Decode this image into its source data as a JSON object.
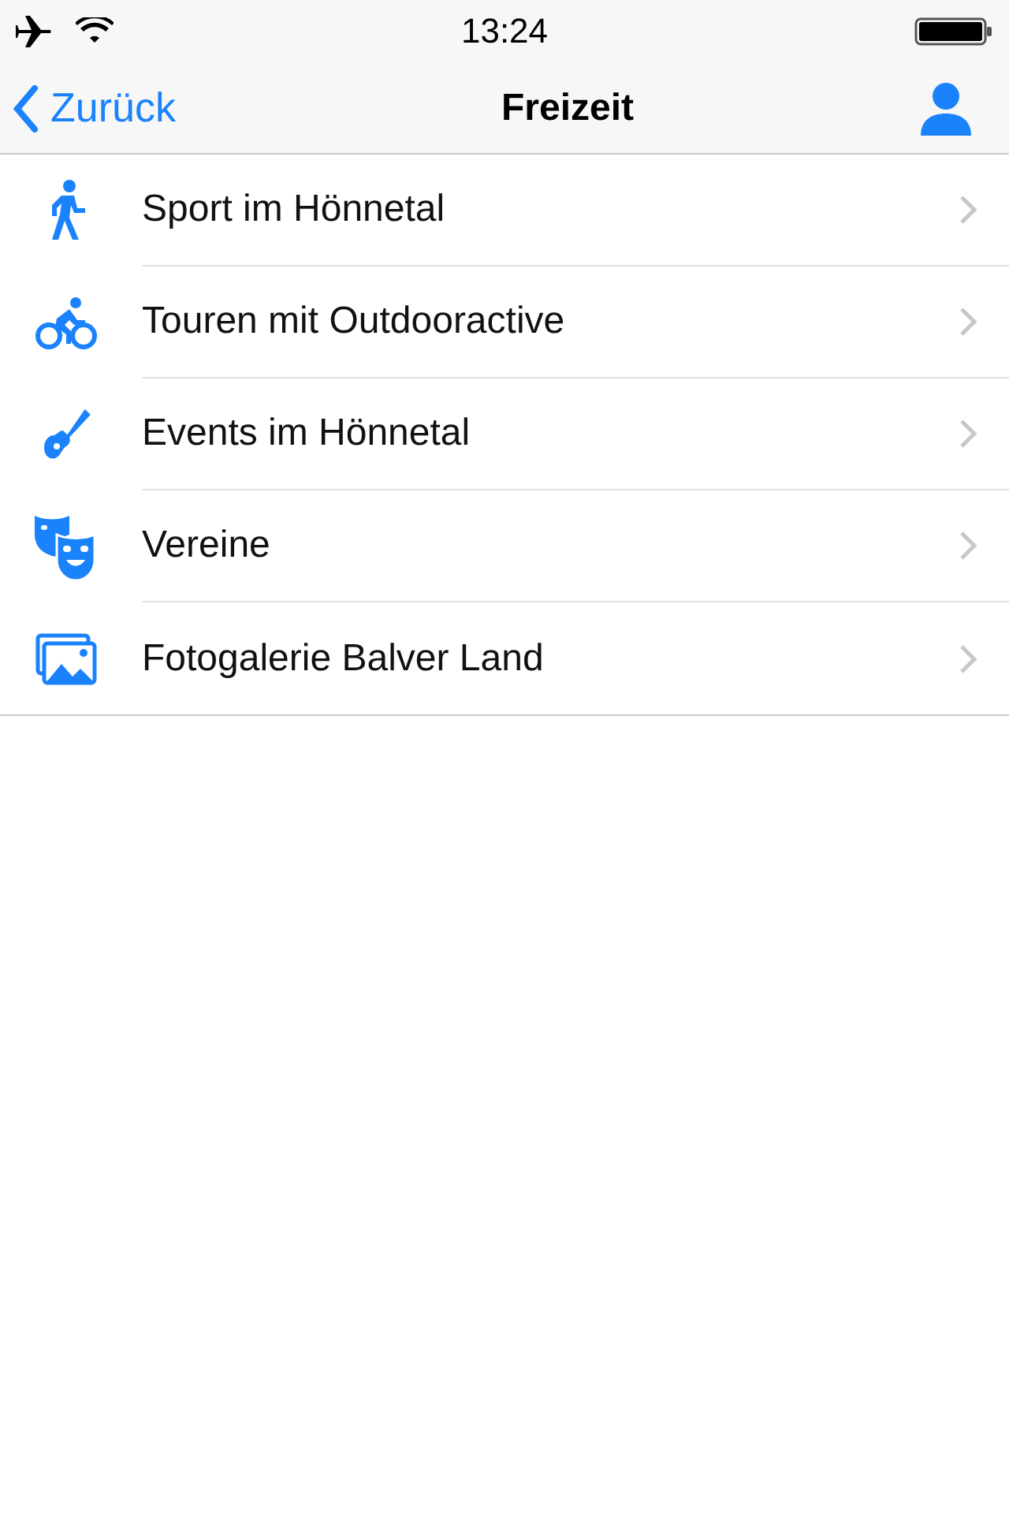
{
  "status_bar": {
    "time": "13:24"
  },
  "nav_bar": {
    "back": "Zurück",
    "title": "Freizeit"
  },
  "items": [
    {
      "kind": "walker",
      "label": "Sport im Hönnetal"
    },
    {
      "kind": "cyclist",
      "label": "Touren mit Outdooractive"
    },
    {
      "kind": "guitar",
      "label": "Events im Hönnetal"
    },
    {
      "kind": "masks",
      "label": "Vereine"
    },
    {
      "kind": "photos",
      "label": "Fotogalerie Balver Land"
    }
  ]
}
